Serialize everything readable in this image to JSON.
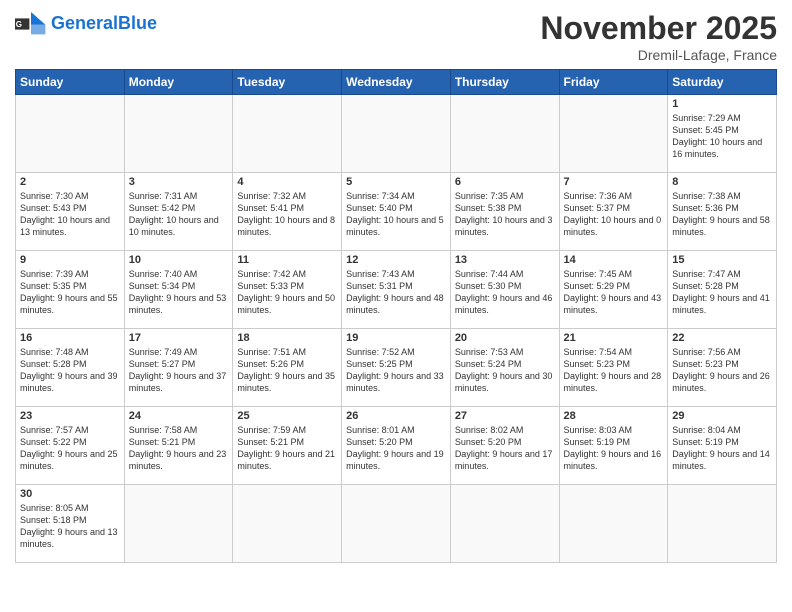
{
  "header": {
    "logo_general": "General",
    "logo_blue": "Blue",
    "month": "November 2025",
    "location": "Dremil-Lafage, France"
  },
  "days_of_week": [
    "Sunday",
    "Monday",
    "Tuesday",
    "Wednesday",
    "Thursday",
    "Friday",
    "Saturday"
  ],
  "weeks": [
    [
      {
        "day": "",
        "info": ""
      },
      {
        "day": "",
        "info": ""
      },
      {
        "day": "",
        "info": ""
      },
      {
        "day": "",
        "info": ""
      },
      {
        "day": "",
        "info": ""
      },
      {
        "day": "",
        "info": ""
      },
      {
        "day": "1",
        "info": "Sunrise: 7:29 AM\nSunset: 5:45 PM\nDaylight: 10 hours and 16 minutes."
      }
    ],
    [
      {
        "day": "2",
        "info": "Sunrise: 7:30 AM\nSunset: 5:43 PM\nDaylight: 10 hours and 13 minutes."
      },
      {
        "day": "3",
        "info": "Sunrise: 7:31 AM\nSunset: 5:42 PM\nDaylight: 10 hours and 10 minutes."
      },
      {
        "day": "4",
        "info": "Sunrise: 7:32 AM\nSunset: 5:41 PM\nDaylight: 10 hours and 8 minutes."
      },
      {
        "day": "5",
        "info": "Sunrise: 7:34 AM\nSunset: 5:40 PM\nDaylight: 10 hours and 5 minutes."
      },
      {
        "day": "6",
        "info": "Sunrise: 7:35 AM\nSunset: 5:38 PM\nDaylight: 10 hours and 3 minutes."
      },
      {
        "day": "7",
        "info": "Sunrise: 7:36 AM\nSunset: 5:37 PM\nDaylight: 10 hours and 0 minutes."
      },
      {
        "day": "8",
        "info": "Sunrise: 7:38 AM\nSunset: 5:36 PM\nDaylight: 9 hours and 58 minutes."
      }
    ],
    [
      {
        "day": "9",
        "info": "Sunrise: 7:39 AM\nSunset: 5:35 PM\nDaylight: 9 hours and 55 minutes."
      },
      {
        "day": "10",
        "info": "Sunrise: 7:40 AM\nSunset: 5:34 PM\nDaylight: 9 hours and 53 minutes."
      },
      {
        "day": "11",
        "info": "Sunrise: 7:42 AM\nSunset: 5:33 PM\nDaylight: 9 hours and 50 minutes."
      },
      {
        "day": "12",
        "info": "Sunrise: 7:43 AM\nSunset: 5:31 PM\nDaylight: 9 hours and 48 minutes."
      },
      {
        "day": "13",
        "info": "Sunrise: 7:44 AM\nSunset: 5:30 PM\nDaylight: 9 hours and 46 minutes."
      },
      {
        "day": "14",
        "info": "Sunrise: 7:45 AM\nSunset: 5:29 PM\nDaylight: 9 hours and 43 minutes."
      },
      {
        "day": "15",
        "info": "Sunrise: 7:47 AM\nSunset: 5:28 PM\nDaylight: 9 hours and 41 minutes."
      }
    ],
    [
      {
        "day": "16",
        "info": "Sunrise: 7:48 AM\nSunset: 5:28 PM\nDaylight: 9 hours and 39 minutes."
      },
      {
        "day": "17",
        "info": "Sunrise: 7:49 AM\nSunset: 5:27 PM\nDaylight: 9 hours and 37 minutes."
      },
      {
        "day": "18",
        "info": "Sunrise: 7:51 AM\nSunset: 5:26 PM\nDaylight: 9 hours and 35 minutes."
      },
      {
        "day": "19",
        "info": "Sunrise: 7:52 AM\nSunset: 5:25 PM\nDaylight: 9 hours and 33 minutes."
      },
      {
        "day": "20",
        "info": "Sunrise: 7:53 AM\nSunset: 5:24 PM\nDaylight: 9 hours and 30 minutes."
      },
      {
        "day": "21",
        "info": "Sunrise: 7:54 AM\nSunset: 5:23 PM\nDaylight: 9 hours and 28 minutes."
      },
      {
        "day": "22",
        "info": "Sunrise: 7:56 AM\nSunset: 5:23 PM\nDaylight: 9 hours and 26 minutes."
      }
    ],
    [
      {
        "day": "23",
        "info": "Sunrise: 7:57 AM\nSunset: 5:22 PM\nDaylight: 9 hours and 25 minutes."
      },
      {
        "day": "24",
        "info": "Sunrise: 7:58 AM\nSunset: 5:21 PM\nDaylight: 9 hours and 23 minutes."
      },
      {
        "day": "25",
        "info": "Sunrise: 7:59 AM\nSunset: 5:21 PM\nDaylight: 9 hours and 21 minutes."
      },
      {
        "day": "26",
        "info": "Sunrise: 8:01 AM\nSunset: 5:20 PM\nDaylight: 9 hours and 19 minutes."
      },
      {
        "day": "27",
        "info": "Sunrise: 8:02 AM\nSunset: 5:20 PM\nDaylight: 9 hours and 17 minutes."
      },
      {
        "day": "28",
        "info": "Sunrise: 8:03 AM\nSunset: 5:19 PM\nDaylight: 9 hours and 16 minutes."
      },
      {
        "day": "29",
        "info": "Sunrise: 8:04 AM\nSunset: 5:19 PM\nDaylight: 9 hours and 14 minutes."
      }
    ],
    [
      {
        "day": "30",
        "info": "Sunrise: 8:05 AM\nSunset: 5:18 PM\nDaylight: 9 hours and 13 minutes."
      },
      {
        "day": "",
        "info": ""
      },
      {
        "day": "",
        "info": ""
      },
      {
        "day": "",
        "info": ""
      },
      {
        "day": "",
        "info": ""
      },
      {
        "day": "",
        "info": ""
      },
      {
        "day": "",
        "info": ""
      }
    ]
  ]
}
